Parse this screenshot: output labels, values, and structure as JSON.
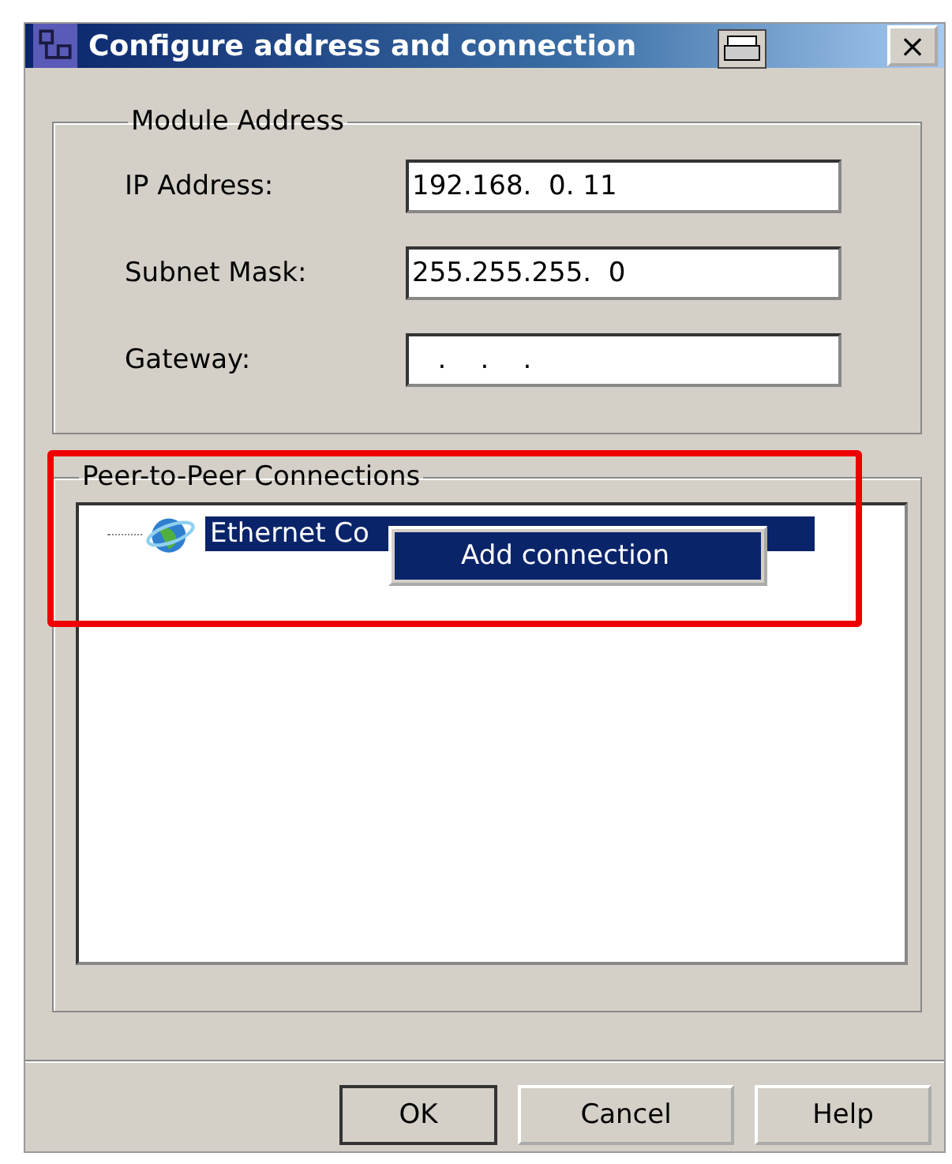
{
  "window": {
    "title": "Configure address and connection",
    "close": "×"
  },
  "module_address": {
    "legend": "Module Address",
    "fields": [
      {
        "label": "IP Address:",
        "value": "192.168.  0. 11"
      },
      {
        "label": "Subnet Mask:",
        "value": "255.255.255.  0"
      },
      {
        "label": "Gateway:",
        "value": "   .    .    ."
      }
    ]
  },
  "peer_connections": {
    "legend": "Peer-to-Peer Connections",
    "tree": [
      {
        "label": "Ethernet Co",
        "selected": true
      }
    ]
  },
  "context_menu": {
    "items": [
      {
        "label": "Add connection",
        "selected": true
      }
    ]
  },
  "buttons": [
    "OK",
    "Cancel",
    "Help"
  ]
}
